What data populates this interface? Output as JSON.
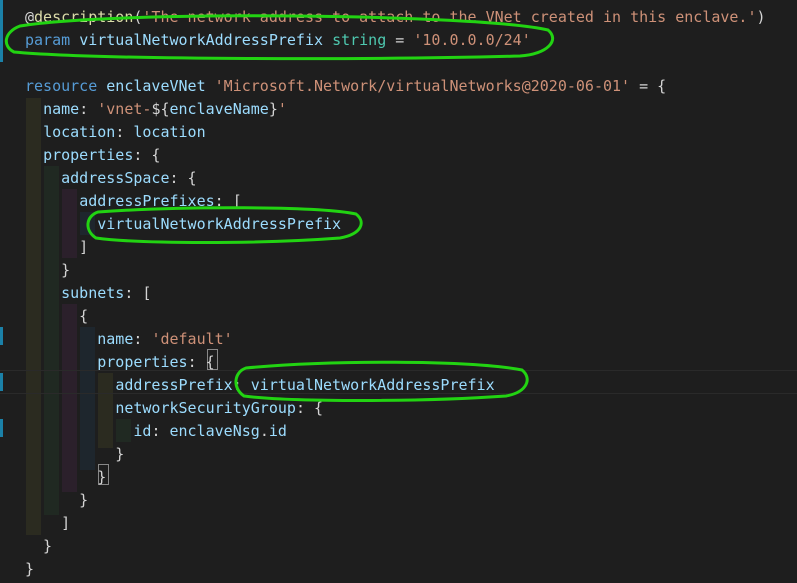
{
  "lines": [
    {
      "tokens": [
        {
          "c": "pun",
          "t": "@"
        },
        {
          "c": "dec",
          "t": "description"
        },
        {
          "c": "pun",
          "t": "("
        },
        {
          "c": "str",
          "t": "'The network address to attach to the VNet created in this enclave.'"
        },
        {
          "c": "pun",
          "t": ")"
        }
      ]
    },
    {
      "tokens": [
        {
          "c": "kw",
          "t": "param "
        },
        {
          "c": "prop",
          "t": "virtualNetworkAddressPrefix"
        },
        {
          "c": "pun",
          "t": " "
        },
        {
          "c": "type",
          "t": "string"
        },
        {
          "c": "pun",
          "t": " = "
        },
        {
          "c": "str",
          "t": "'10.0.0.0/24'"
        }
      ]
    },
    {
      "tokens": []
    },
    {
      "tokens": [
        {
          "c": "kw",
          "t": "resource "
        },
        {
          "c": "prop",
          "t": "enclaveVNet"
        },
        {
          "c": "pun",
          "t": " "
        },
        {
          "c": "str",
          "t": "'Microsoft.Network/virtualNetworks@2020-06-01'"
        },
        {
          "c": "pun",
          "t": " = {"
        }
      ]
    },
    {
      "tokens": [
        {
          "c": "pun",
          "t": "  "
        },
        {
          "c": "prop",
          "t": "name"
        },
        {
          "c": "pun",
          "t": ": "
        },
        {
          "c": "str",
          "t": "'vnet-"
        },
        {
          "c": "pun",
          "t": "${"
        },
        {
          "c": "prop",
          "t": "enclaveName"
        },
        {
          "c": "pun",
          "t": "}"
        },
        {
          "c": "str",
          "t": "'"
        }
      ]
    },
    {
      "tokens": [
        {
          "c": "pun",
          "t": "  "
        },
        {
          "c": "prop",
          "t": "location"
        },
        {
          "c": "pun",
          "t": ": "
        },
        {
          "c": "prop",
          "t": "location"
        }
      ]
    },
    {
      "tokens": [
        {
          "c": "pun",
          "t": "  "
        },
        {
          "c": "prop",
          "t": "properties"
        },
        {
          "c": "pun",
          "t": ": {"
        }
      ]
    },
    {
      "tokens": [
        {
          "c": "pun",
          "t": "    "
        },
        {
          "c": "prop",
          "t": "addressSpace"
        },
        {
          "c": "pun",
          "t": ": {"
        }
      ]
    },
    {
      "tokens": [
        {
          "c": "pun",
          "t": "      "
        },
        {
          "c": "prop",
          "t": "addressPrefixes"
        },
        {
          "c": "pun",
          "t": ": ["
        }
      ]
    },
    {
      "tokens": [
        {
          "c": "pun",
          "t": "        "
        },
        {
          "c": "prop",
          "t": "virtualNetworkAddressPrefix"
        }
      ]
    },
    {
      "tokens": [
        {
          "c": "pun",
          "t": "      ]"
        }
      ]
    },
    {
      "tokens": [
        {
          "c": "pun",
          "t": "    }"
        }
      ]
    },
    {
      "tokens": [
        {
          "c": "pun",
          "t": "    "
        },
        {
          "c": "prop",
          "t": "subnets"
        },
        {
          "c": "pun",
          "t": ": ["
        }
      ]
    },
    {
      "tokens": [
        {
          "c": "pun",
          "t": "      {"
        }
      ]
    },
    {
      "tokens": [
        {
          "c": "pun",
          "t": "        "
        },
        {
          "c": "prop",
          "t": "name"
        },
        {
          "c": "pun",
          "t": ": "
        },
        {
          "c": "str",
          "t": "'default'"
        }
      ]
    },
    {
      "tokens": [
        {
          "c": "pun",
          "t": "        "
        },
        {
          "c": "prop",
          "t": "properties"
        },
        {
          "c": "pun",
          "t": ": {"
        }
      ]
    },
    {
      "tokens": [
        {
          "c": "pun",
          "t": "          "
        },
        {
          "c": "prop",
          "t": "addressPrefix"
        },
        {
          "c": "pun",
          "t": ": "
        },
        {
          "c": "prop",
          "t": "virtualNetworkAddressPrefix"
        }
      ]
    },
    {
      "tokens": [
        {
          "c": "pun",
          "t": "          "
        },
        {
          "c": "prop",
          "t": "networkSecurityGroup"
        },
        {
          "c": "pun",
          "t": ": {"
        }
      ]
    },
    {
      "tokens": [
        {
          "c": "pun",
          "t": "            "
        },
        {
          "c": "prop",
          "t": "id"
        },
        {
          "c": "pun",
          "t": ": "
        },
        {
          "c": "prop",
          "t": "enclaveNsg"
        },
        {
          "c": "pun",
          "t": "."
        },
        {
          "c": "prop",
          "t": "id"
        }
      ]
    },
    {
      "tokens": [
        {
          "c": "pun",
          "t": "          }"
        }
      ]
    },
    {
      "tokens": [
        {
          "c": "pun",
          "t": "        }"
        }
      ]
    },
    {
      "tokens": [
        {
          "c": "pun",
          "t": "      }"
        }
      ]
    },
    {
      "tokens": [
        {
          "c": "pun",
          "t": "    ]"
        }
      ]
    },
    {
      "tokens": [
        {
          "c": "pun",
          "t": "  }"
        }
      ]
    },
    {
      "tokens": [
        {
          "c": "pun",
          "t": "}"
        }
      ]
    }
  ],
  "colors": {
    "background": "#1e1e1e",
    "keyword": "#569cd6",
    "string": "#ce9178",
    "property": "#9cdcfe",
    "type": "#4ec9b0",
    "decorator": "#dcdcaa",
    "highlight": "#22d312"
  },
  "annotations": {
    "highlight_count": 3,
    "highlighted_lines": [
      1,
      9,
      16
    ]
  }
}
